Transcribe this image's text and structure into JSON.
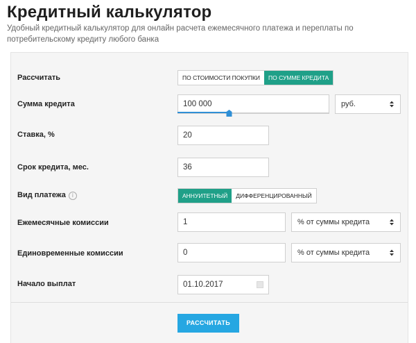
{
  "header": {
    "title": "Кредитный калькулятор",
    "subtitle": "Удобный кредитный калькулятор для онлайн расчета ежемесячного платежа и переплаты по потребительскому кредиту любого банка"
  },
  "form": {
    "calc_mode": {
      "label": "Рассчитать",
      "options": [
        "по стоимости покупки",
        "по сумме кредита"
      ],
      "selected": "по сумме кредита"
    },
    "loan_amount": {
      "label": "Сумма кредита",
      "value": "100 000",
      "currency": "руб.",
      "slider_level": 0.34
    },
    "rate": {
      "label": "Ставка, %",
      "value": "20"
    },
    "term": {
      "label": "Срок кредита, мес.",
      "value": "36"
    },
    "payment_type": {
      "label": "Вид платежа",
      "info_icon": "i",
      "options": [
        "аннуитетный",
        "дифференцированный"
      ],
      "selected": "аннуитетный"
    },
    "monthly_fees": {
      "label": "Ежемесячные комиссии",
      "value": "1",
      "unit": "% от суммы кредита"
    },
    "one_time_fees": {
      "label": "Единовременные комиссии",
      "value": "0",
      "unit": "% от суммы кредита"
    },
    "start_date": {
      "label": "Начало выплат",
      "value": "01.10.2017"
    },
    "submit_label": "Рассчитать"
  },
  "colors": {
    "accent_green": "#1fa088",
    "button_blue": "#26a7e2",
    "slider_blue": "#2f8fd6"
  },
  "icons": [
    "info-icon",
    "select-arrows-icon",
    "calendar-icon",
    "slider-handle-icon"
  ]
}
